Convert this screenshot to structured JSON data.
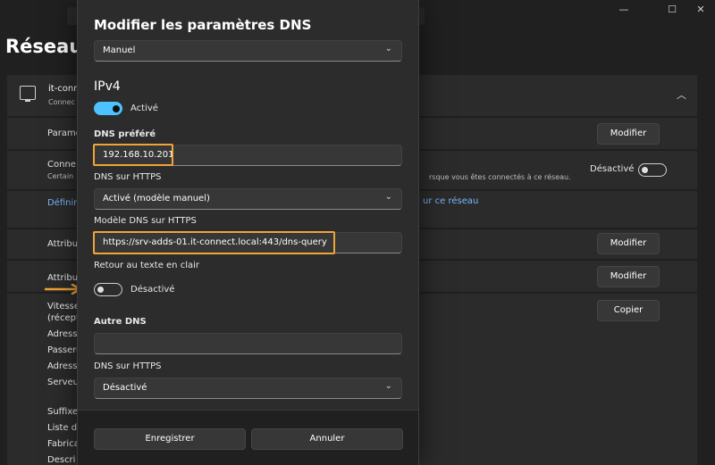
{
  "background": {
    "page_title": "Réseau e",
    "window_controls": [
      "—",
      "☐",
      "✕"
    ],
    "adapter": {
      "name": "it-conn",
      "status": "Connec"
    },
    "rows": [
      {
        "label": "Parame",
        "button": "Modifier"
      },
      {
        "label": "Conne",
        "sub": "Certain",
        "description": "rsque vous êtes connectés à ce réseau.",
        "toggle_label": "Désactivé"
      },
      {
        "link_left": "Définir",
        "link_right": "ur ce réseau"
      },
      {
        "label": "Attribu",
        "button": "Modifier"
      },
      {
        "label": "Attribu",
        "button": "Modifier"
      },
      {
        "label": "Vitesse",
        "sub": "(récept",
        "button": "Copier"
      }
    ],
    "list_labels": [
      "Adress",
      "Passere",
      "Adress",
      "Serveu",
      "Suffixe",
      "Liste d",
      "Fabrica",
      "Descri"
    ]
  },
  "dialog": {
    "title": "Modifier les paramètres DNS",
    "mode_select": "Manuel",
    "ipv4_heading": "IPv4",
    "ipv4_toggle_label": "Activé",
    "preferred_dns_label": "DNS préféré",
    "preferred_dns_value": "192.168.10.201",
    "dns_https_label_1": "DNS sur HTTPS",
    "dns_https_select_1": "Activé (modèle manuel)",
    "https_template_label": "Modèle DNS sur HTTPS",
    "https_template_value": "https://srv-adds-01.it-connect.local:443/dns-query",
    "fallback_label": "Retour au texte en clair",
    "fallback_toggle_label": "Désactivé",
    "alternate_dns_label": "Autre DNS",
    "alternate_dns_value": "",
    "dns_https_label_2": "DNS sur HTTPS",
    "dns_https_select_2": "Désactivé",
    "save_button": "Enregistrer",
    "cancel_button": "Annuler"
  },
  "colors": {
    "accent_toggle": "#4cc2ff",
    "highlight": "#f0a336",
    "link": "#78b8ff"
  }
}
